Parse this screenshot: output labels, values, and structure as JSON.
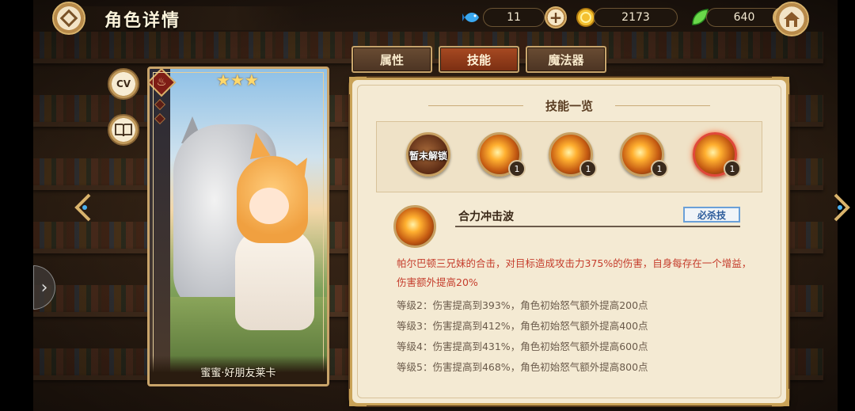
{
  "header": {
    "title": "角色详情",
    "resources": [
      {
        "name": "fish",
        "icon": "fish-icon",
        "value": "11"
      },
      {
        "name": "gold",
        "icon": "coin-icon",
        "value": "2173"
      },
      {
        "name": "gem",
        "icon": "leaf-gem-icon",
        "value": "640"
      }
    ]
  },
  "left_buttons": {
    "cv_label": "CV"
  },
  "card": {
    "stars": "★★★",
    "name": "蜜蜜·好朋友莱卡"
  },
  "tabs": [
    {
      "label": "属性",
      "active": false
    },
    {
      "label": "技能",
      "active": true
    },
    {
      "label": "魔法器",
      "active": false
    }
  ],
  "skills": {
    "section_title": "技能一览",
    "locked_text": "暂未解锁",
    "icons": [
      {
        "locked": true,
        "level": ""
      },
      {
        "locked": false,
        "level": "1"
      },
      {
        "locked": false,
        "level": "1"
      },
      {
        "locked": false,
        "level": "1"
      },
      {
        "locked": false,
        "level": "1",
        "selected": true
      }
    ]
  },
  "detail": {
    "name": "合力冲击波",
    "tag": "必杀技",
    "description": "帕尔巴顿三兄妹的合击，对目标造成攻击力375%的伤害，自身每存在一个增益，伤害额外提高20%",
    "levels": [
      "等级2：伤害提高到393%，角色初始怒气额外提高200点",
      "等级3：伤害提高到412%，角色初始怒气额外提高400点",
      "等级4：伤害提高到431%，角色初始怒气额外提高600点",
      "等级5：伤害提高到468%，角色初始怒气额外提高800点"
    ]
  },
  "colors": {
    "accent": "#c9a257",
    "desc_red": "#c53d2c",
    "active_tab": "#a84a22"
  }
}
